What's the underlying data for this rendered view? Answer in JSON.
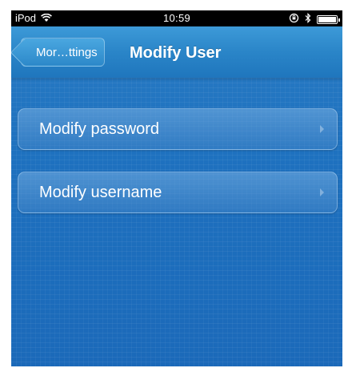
{
  "status_bar": {
    "carrier": "iPod",
    "time": "10:59",
    "icons": [
      "wifi-icon",
      "rotation-lock-icon",
      "bluetooth-icon",
      "battery-icon"
    ]
  },
  "nav": {
    "back_label": "Mor…ttings",
    "title": "Modify User"
  },
  "rows": [
    {
      "label": "Modify password"
    },
    {
      "label": "Modify username"
    }
  ]
}
